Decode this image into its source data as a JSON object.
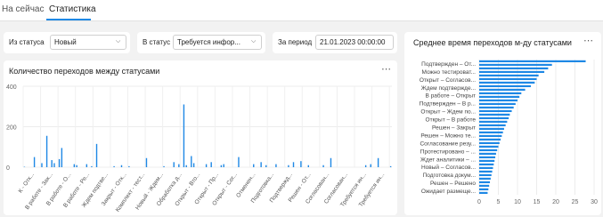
{
  "tabs": [
    {
      "label": "На сейчас",
      "active": false
    },
    {
      "label": "Статистика",
      "active": true
    }
  ],
  "filters": {
    "from_status": {
      "label": "Из статуса",
      "value": "Новый"
    },
    "to_status": {
      "label": "В статус",
      "value": "Требуется инфор..."
    },
    "period": {
      "label": "За период",
      "value": "21.01.2023 00:00:00"
    }
  },
  "left_card": {
    "title": "Количество переходов между статусами"
  },
  "right_card": {
    "title": "Среднее время переходов м-ду статусами"
  },
  "accent_color": "#1e88e5",
  "chart_data": [
    {
      "type": "bar",
      "orientation": "vertical",
      "title": "Количество переходов между статусами",
      "ylim": [
        0,
        400
      ],
      "yticks": [
        0,
        200,
        400
      ],
      "grid": true,
      "x_tick_labels": [
        "К - Отк...",
        "В работе - Зак...",
        "В работе - О...",
        "В работе - Ре...",
        "Ждем подтве...",
        "Закрыт - Отк...",
        "Комплект - тест...",
        "Новый - Ждем...",
        "Обработка д...",
        "Открыт - Вто...",
        "Открыт - Пр...",
        "Открыт - Сог...",
        "Отменен...",
        "Подготовка...",
        "Подтвержд...",
        "Решен - От...",
        "Согласован...",
        "Согласован...",
        "Требуется ин...",
        "Требуется ин..."
      ],
      "values": [
        2,
        0,
        0,
        0,
        50,
        0,
        0,
        20,
        0,
        155,
        0,
        35,
        20,
        0,
        40,
        95,
        0,
        0,
        0,
        0,
        15,
        10,
        0,
        0,
        0,
        15,
        0,
        5,
        0,
        115,
        0,
        0,
        0,
        0,
        0,
        0,
        5,
        0,
        0,
        10,
        0,
        0,
        5,
        0,
        0,
        0,
        0,
        0,
        0,
        45,
        0,
        0,
        0,
        0,
        0,
        0,
        5,
        0,
        0,
        0,
        25,
        0,
        15,
        0,
        310,
        10,
        0,
        55,
        20,
        0,
        0,
        0,
        0,
        15,
        0,
        25,
        0,
        0,
        0,
        10,
        15,
        0,
        0,
        0,
        0,
        0,
        50,
        0,
        0,
        0,
        0,
        0,
        15,
        0,
        0,
        25,
        0,
        10,
        0,
        0,
        0,
        15,
        0,
        0,
        0,
        0,
        10,
        0,
        25,
        0,
        0,
        30,
        0,
        0,
        10,
        0,
        0,
        0,
        0,
        0,
        10,
        0,
        0,
        45,
        0,
        0,
        0,
        0,
        0,
        0,
        0,
        0,
        0,
        0,
        0,
        0,
        0,
        10,
        0,
        15,
        0,
        0,
        45,
        0,
        0,
        0,
        0,
        5
      ]
    },
    {
      "type": "bar",
      "orientation": "horizontal",
      "title": "Среднее время переходов м-ду статусами",
      "xlim": [
        0,
        30
      ],
      "xticks": [
        0,
        5,
        10,
        15,
        20,
        25,
        30
      ],
      "grid": true,
      "category_labels": [
        "Подтвержден – От...",
        "Можно тестироват...",
        "Открыт – Согласов...",
        "Ждем подтвержде...",
        "В работе – Открыт",
        "Подтвержден – В р...",
        "Открыт – Ждем по...",
        "Открыт – В работе",
        "Решен – Закрыт",
        "Решен – Можно те...",
        "Согласование резу...",
        "Протестировано – ...",
        "Ждет аналитики – ...",
        "Новый – Согласов...",
        "Подготовка докум...",
        "Решен – Решено",
        "Ожидает размеще..."
      ],
      "values": [
        27.8,
        19,
        18,
        17,
        15.5,
        15,
        14.5,
        13.5,
        12,
        11,
        10.5,
        10,
        9.5,
        9,
        8.5,
        8,
        7.7,
        7.3,
        6.9,
        6.5,
        6.2,
        5.9,
        5.6,
        5.3,
        5,
        4.7,
        4.4,
        4.2,
        4,
        3.8,
        3.6,
        3.4,
        3.2,
        3,
        2.8,
        2.6,
        2.4,
        2.2
      ]
    }
  ]
}
